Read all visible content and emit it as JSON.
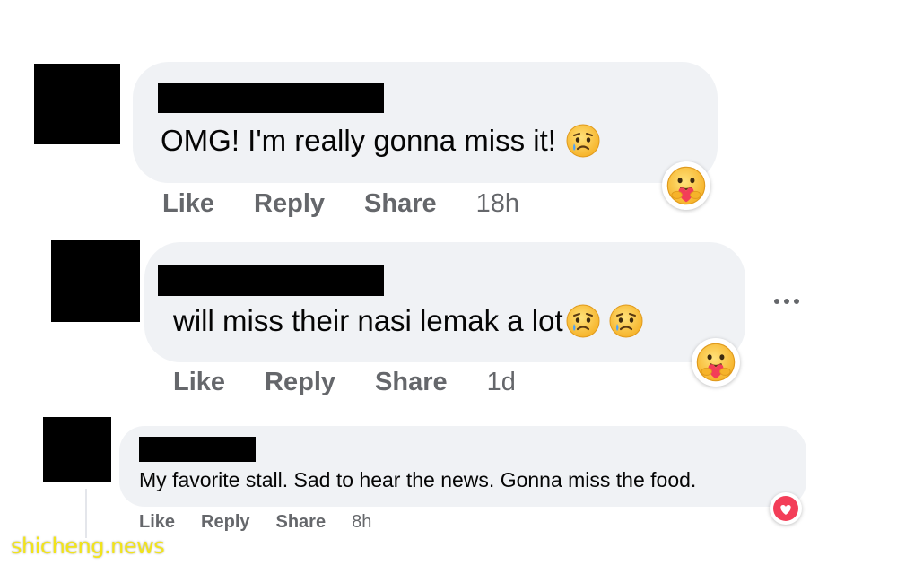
{
  "comments": [
    {
      "text": "OMG! I'm really gonna miss it!",
      "inline_emoji": [
        "sad-but-relieved-face"
      ],
      "reaction": "care-hug",
      "actions": {
        "like": "Like",
        "reply": "Reply",
        "share": "Share"
      },
      "time": "18h"
    },
    {
      "text": "will miss their nasi lemak a lot",
      "inline_emoji": [
        "sad-but-relieved-face",
        "sad-but-relieved-face"
      ],
      "reaction": "care-hug",
      "actions": {
        "like": "Like",
        "reply": "Reply",
        "share": "Share"
      },
      "time": "1d"
    },
    {
      "text": "My favorite stall. Sad to hear the news. Gonna miss the food.",
      "inline_emoji": [],
      "reaction": "love-heart",
      "actions": {
        "like": "Like",
        "reply": "Reply",
        "share": "Share"
      },
      "time": "8h"
    }
  ],
  "more_icon": "more-horizontal-icon",
  "watermark": "shicheng.news",
  "colors": {
    "bubble": "#f0f2f5",
    "action_text": "#65676b",
    "love_red": "#f33e58",
    "emoji_yellow": "#ffc83d",
    "watermark": "#f2e419"
  }
}
